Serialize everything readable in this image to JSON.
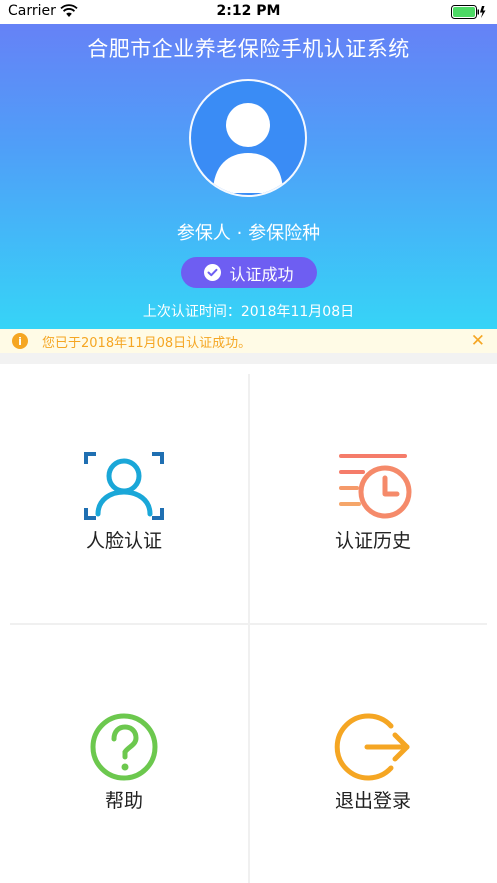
{
  "status_bar": {
    "carrier": "Carrier",
    "time": "2:12 PM"
  },
  "header": {
    "title": "合肥市企业养老保险手机认证系统",
    "insured_name": "参保人 · 参保险种",
    "badge_label": "认证成功",
    "last_auth": "上次认证时间：2018年11月08日"
  },
  "notice": {
    "text": "您已于2018年11月08日认证成功。",
    "icon": "info-icon",
    "close": "✕"
  },
  "menu": [
    {
      "label": "人脸认证",
      "icon": "face-scan-icon"
    },
    {
      "label": "认证历史",
      "icon": "history-clock-icon"
    },
    {
      "label": "帮助",
      "icon": "help-question-icon"
    },
    {
      "label": "退出登录",
      "icon": "logout-icon"
    }
  ],
  "colors": {
    "gradient_top": "#6a7cf6",
    "gradient_bottom": "#36d4f7",
    "badge": "#6e5ef2",
    "notice_text": "#f5a623",
    "face_icon": "#1aa7d8",
    "history_icon": "#f57c6a",
    "help_icon": "#6cc84e",
    "logout_icon": "#f5a623"
  }
}
